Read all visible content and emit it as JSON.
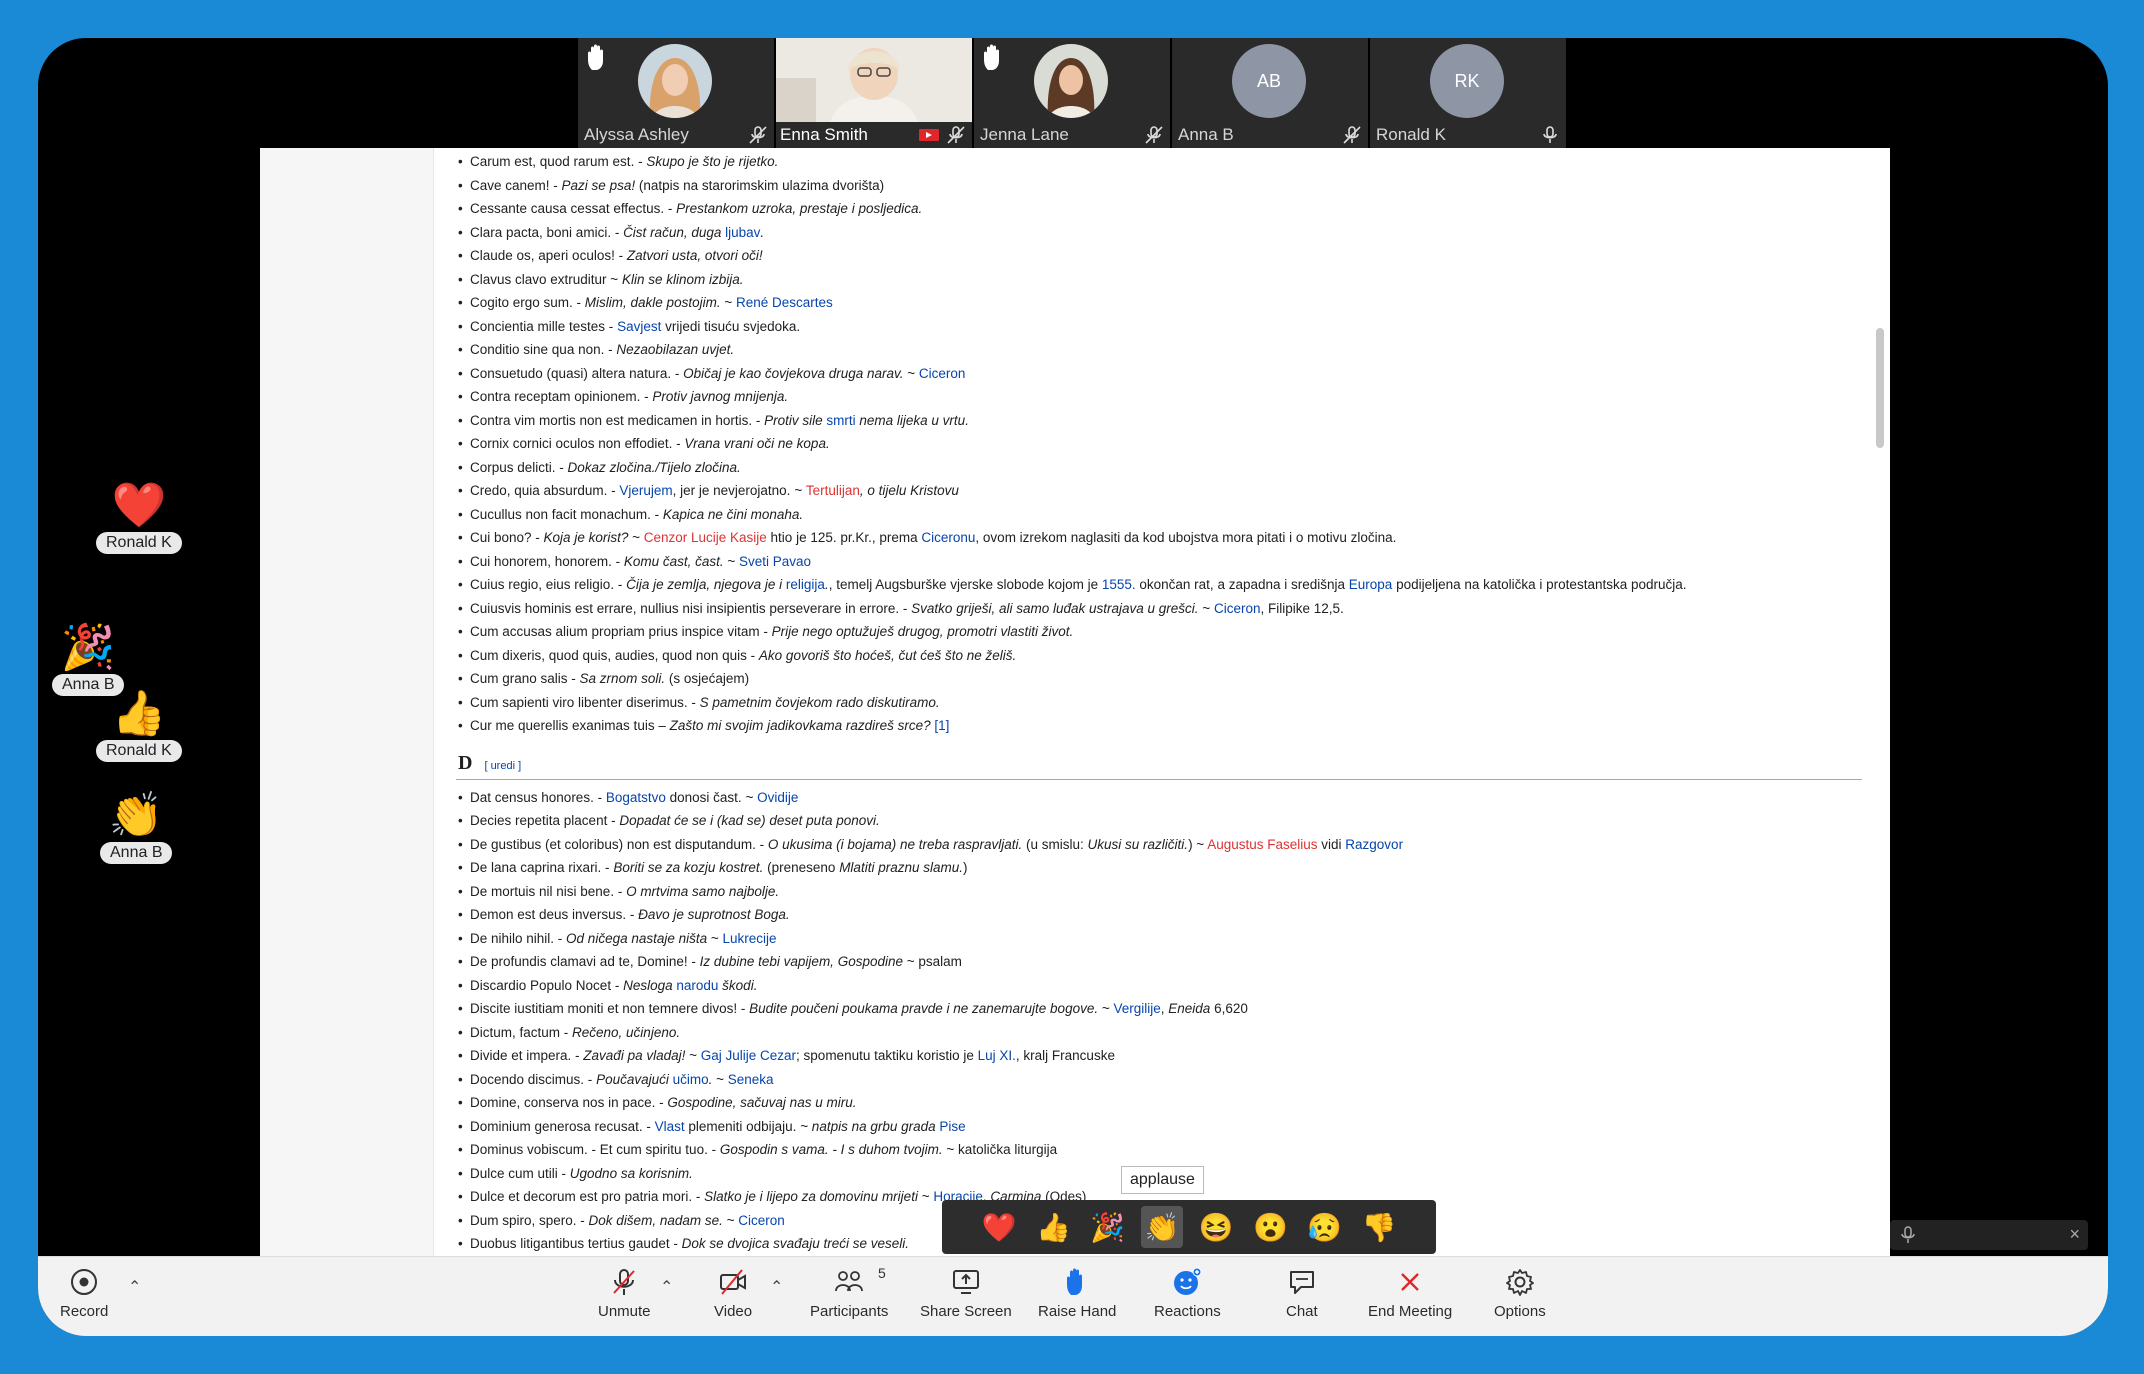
{
  "participants": [
    {
      "name": "Alyssa Ashley",
      "hand_raised": true,
      "muted": true
    },
    {
      "name": "Enna Smith",
      "hand_raised": false,
      "muted": true,
      "sharing": true
    },
    {
      "name": "Jenna Lane",
      "hand_raised": true,
      "muted": true
    },
    {
      "name": "Anna B",
      "initials": "AB",
      "hand_raised": false,
      "muted": true
    },
    {
      "name": "Ronald K",
      "initials": "RK",
      "hand_raised": false,
      "muted": false
    }
  ],
  "document": {
    "section_d": {
      "heading": "D",
      "edit_label": "[ uredi ]"
    },
    "items_c": [
      [
        "Carum est, quod rarum est. - ",
        "Skupo je što je rijetko."
      ],
      [
        "Cave canem! - ",
        "Pazi se psa!",
        " (natpis na starorimskim ulazima dvorišta)"
      ],
      [
        "Cessante causa cessat effectus. - ",
        "Prestankom uzroka, prestaje i posljedica."
      ],
      [
        "Clara pacta, boni amici. - ",
        "Čist račun, duga ",
        "ljubav",
        "."
      ],
      [
        "Claude os, aperi oculos! - ",
        "Zatvori usta, otvori oči!"
      ],
      [
        "Clavus clavo extruditur ~ ",
        "Klin se klinom izbija."
      ],
      [
        "Cogito ergo sum. - ",
        "Mislim, dakle postojim.",
        " ~ ",
        "René Descartes"
      ],
      [
        "Concientia mille testes - ",
        "Savjest",
        " vrijedi tisuću svjedoka."
      ],
      [
        "Conditio sine qua non. - ",
        "Nezaobilazan uvjet."
      ],
      [
        "Consuetudo (quasi) altera natura. - ",
        "Običaj je kao čovjekova druga narav.",
        " ~ ",
        "Ciceron"
      ],
      [
        "Contra receptam opinionem. - ",
        "Protiv javnog mnijenja."
      ],
      [
        "Contra vim mortis non est medicamen in hortis. - ",
        "Protiv sile ",
        "smrti",
        " nema lijeka u vrtu."
      ],
      [
        "Cornix cornici oculos non effodiet. - ",
        "Vrana vrani oči ne kopa."
      ],
      [
        "Corpus delicti. - ",
        "Dokaz zločina./Tijelo zločina."
      ],
      [
        "Credo, quia absurdum. - ",
        "Vjerujem",
        ", jer je nevjerojatno.",
        " ~ ",
        "Tertulijan",
        ", o tijelu Kristovu"
      ],
      [
        "Cucullus non facit monachum. - ",
        "Kapica ne čini monaha."
      ],
      [
        "Cui bono? - ",
        "Koja je korist?",
        " ~ ",
        "Cenzor Lucije Kasije",
        " htio je 125. pr.Kr., prema ",
        "Ciceronu",
        ", ovom izrekom naglasiti da kod ubojstva mora pitati i o motivu zločina."
      ],
      [
        "Cui honorem, honorem. - ",
        "Komu čast, čast.",
        " ~ ",
        "Sveti Pavao"
      ],
      [
        "Cuius regio, eius religio. - ",
        "Čija je zemlja, njegova je i ",
        "religija",
        ".",
        ", temelj Augsburške vjerske slobode kojom je ",
        "1555.",
        " okončan rat, a zapadna i središnja ",
        "Europa",
        " podijeljena na katolička i protestantska područja."
      ],
      [
        "Cuiusvis hominis est errare, nullius nisi insipientis perseverare in errore. - ",
        "Svatko griješi, ali samo luđak ustrajava u grešci.",
        " ~ ",
        "Ciceron",
        ", Filipike 12,5."
      ],
      [
        "Cum accusas alium propriam prius inspice vitam - ",
        "Prije nego optužuješ drugog, promotri vlastiti život."
      ],
      [
        "Cum dixeris, quod quis, audies, quod non quis - ",
        "Ako govoriš što hoćeš, čut ćeš što ne želiš."
      ],
      [
        "Cum grano salis - ",
        "Sa zrnom soli.",
        " (s osjećajem)"
      ],
      [
        "Cum sapienti viro libenter diserimus. - ",
        "S pametnim čovjekom rado diskutiramo."
      ],
      [
        "Cur me querellis exanimas tuis – ",
        "Zašto mi svojim jadikovkama razdireš srce?",
        " [1]"
      ]
    ],
    "items_d": [
      [
        "Dat census honores. - ",
        "Bogatstvo",
        " donosi čast.",
        " ~ ",
        "Ovidije"
      ],
      [
        "Decies repetita placent - ",
        "Dopadat će se i (kad se) deset puta ponovi."
      ],
      [
        "De gustibus (et coloribus) non est disputandum. - ",
        "O ukusima (i bojama) ne treba raspravljati.",
        " (u smislu: ",
        "Ukusi su različiti.",
        ") ~ ",
        "Augustus Faselius",
        " vidi ",
        "Razgovor"
      ],
      [
        "De lana caprina rixari. - ",
        "Boriti se za kozju kostret.",
        " (preneseno ",
        "Mlatiti praznu slamu.",
        ")"
      ],
      [
        "De mortuis nil nisi bene. - ",
        "O mrtvima samo najbolje."
      ],
      [
        "Demon est deus inversus. - ",
        "Đavo je suprotnost Boga."
      ],
      [
        "De nihilo nihil. - ",
        "Od ničega nastaje ništa",
        " ~ ",
        "Lukrecije"
      ],
      [
        "De profundis clamavi ad te, Domine! - ",
        "Iz dubine tebi vapijem, Gospodine",
        " ~ psalam"
      ],
      [
        "Discardio Populo Nocet - ",
        "Nesloga ",
        "narodu",
        " škodi."
      ],
      [
        "Discite iustitiam moniti et non temnere divos! - ",
        "Budite poučeni poukama pravde i ne zanemarujte bogove.",
        " ~ ",
        "Vergilije",
        ", ",
        "Eneida",
        " 6,620"
      ],
      [
        "Dictum, factum - ",
        "Rečeno, učinjeno."
      ],
      [
        "Divide et impera. - ",
        "Zavađi pa vladaj!",
        " ~ ",
        "Gaj Julije Cezar",
        "; spomenutu taktiku koristio je ",
        "Luj XI.",
        ", kralj Francuske"
      ],
      [
        "Docendo discimus. - ",
        "Poučavajući ",
        "učimo",
        ".",
        " ~ ",
        "Seneka"
      ],
      [
        "Domine, conserva nos in pace. - ",
        "Gospodine, sačuvaj nas u miru."
      ],
      [
        "Dominium generosa recusat. - ",
        "Vlast",
        " plemeniti odbijaju.",
        " ~ natpis na grbu grada ",
        "Pise"
      ],
      [
        "Dominus vobiscum. - Et cum spiritu tuo. - ",
        "Gospodin s vama. - I s duhom tvojim.",
        " ~ katolička liturgija"
      ],
      [
        "Dulce cum utili - ",
        "Ugodno sa korisnim."
      ],
      [
        "Dulce et decorum est pro patria mori. - ",
        "Slatko je i lijepo za domovinu mrijeti",
        " ~ ",
        "Horacije",
        ", ",
        "Carmina",
        " (Odes)"
      ],
      [
        "Dum spiro, spero. - ",
        "Dok dišem, nadam se.",
        " ~ ",
        "Ciceron"
      ],
      [
        "Duobus litigantibus tertius gaudet - ",
        "Dok se dvojica svađaju treći se veseli."
      ]
    ]
  },
  "floating_reactions": [
    {
      "emoji": "❤️",
      "name": "Ronald K"
    },
    {
      "emoji": "🎉",
      "name": "Anna B"
    },
    {
      "emoji": "👍",
      "name": "Ronald K"
    },
    {
      "emoji": "👏",
      "name": "Anna B"
    }
  ],
  "reaction_bar": {
    "tooltip": "applause",
    "emojis": [
      "❤️",
      "👍",
      "🎉",
      "👏",
      "😆",
      "😮",
      "😥",
      "👎"
    ]
  },
  "toolbar": {
    "record": "Record",
    "unmute": "Unmute",
    "video": "Video",
    "participants": "Participants",
    "participants_count": "5",
    "share_screen": "Share Screen",
    "raise_hand": "Raise Hand",
    "reactions": "Reactions",
    "chat": "Chat",
    "end_meeting": "End Meeting",
    "options": "Options"
  },
  "colors": {
    "accent": "#1a8ad6",
    "end_meeting": "#e0262b",
    "link": "#0645ad",
    "redlink": "#dd3333"
  }
}
